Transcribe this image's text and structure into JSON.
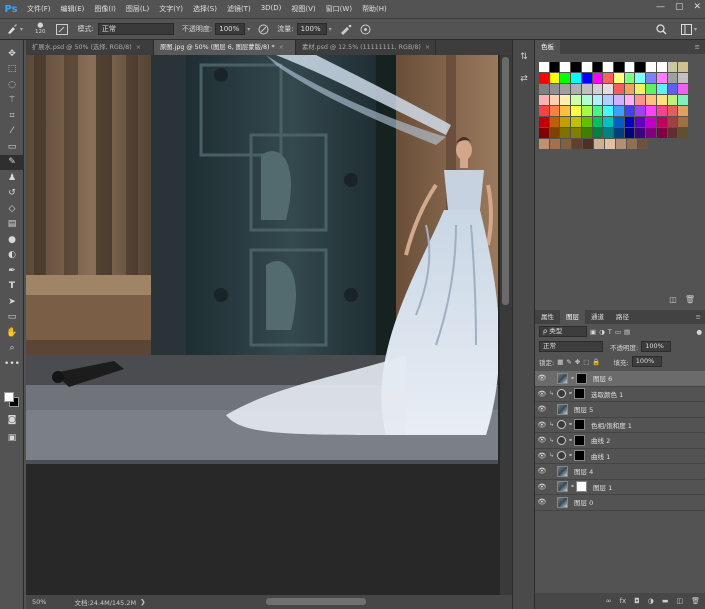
{
  "app": {
    "logo": "Ps",
    "menu": [
      "文件(F)",
      "编辑(E)",
      "图像(I)",
      "图层(L)",
      "文字(Y)",
      "选择(S)",
      "滤镜(T)",
      "3D(D)",
      "视图(V)",
      "窗口(W)",
      "帮助(H)"
    ],
    "window_controls": [
      "—",
      "▢",
      "✕"
    ]
  },
  "options": {
    "brush_size": "120",
    "mode_label": "模式:",
    "mode_value": "正常",
    "opacity_label": "不透明度:",
    "opacity_value": "100%",
    "flow_label": "流量:",
    "flow_value": "100%"
  },
  "tabs": [
    {
      "label": "扩展水.psd @ 50% (选择, RGB/8)",
      "close": "×"
    },
    {
      "label": "原图.jpg @ 50% (图层 6, 图层蒙版/8) *",
      "close": "×",
      "active": true
    },
    {
      "label": "素材.psd @ 12.5% (11111111, RGB/8)",
      "close": "×"
    }
  ],
  "status": {
    "zoom": "50%",
    "doc": "文档:24.4M/145.2M"
  },
  "swatches_panel": {
    "title": "色板",
    "menu": "≡",
    "colors": [
      [
        "#ffffff",
        "#000000",
        "#ffffff",
        "#000000",
        "#ffffff",
        "#000000",
        "#ffffff",
        "#000000",
        "#ffffff",
        "#000000",
        "#ffffff",
        "#ffffff",
        "#c8c8a0",
        "#d0c090"
      ],
      [
        "#ff0000",
        "#ffff00",
        "#00ff00",
        "#00ffff",
        "#0000ff",
        "#ff00ff",
        "#ff6060",
        "#ffff80",
        "#80ff80",
        "#80ffff",
        "#8080ff",
        "#ff80ff",
        "#a0a0a0",
        "#c0c0c0"
      ],
      [
        "#808080",
        "#909090",
        "#a0a0a0",
        "#b0b0b0",
        "#c0c0c0",
        "#d0d0d0",
        "#e0e0e0",
        "#f06060",
        "#f0a060",
        "#f0f060",
        "#60f060",
        "#60f0f0",
        "#6060f0",
        "#f060f0"
      ],
      [
        "#ffb0b0",
        "#ffd0b0",
        "#fff0b0",
        "#d0ffb0",
        "#b0ffd0",
        "#b0f0ff",
        "#b0d0ff",
        "#d0b0ff",
        "#ffb0f0",
        "#ff9090",
        "#ffc080",
        "#ffe080",
        "#c0f080",
        "#80f0c0"
      ],
      [
        "#ff4040",
        "#ff8040",
        "#ffc040",
        "#ffff40",
        "#a0ff40",
        "#40ff80",
        "#40ffff",
        "#40a0ff",
        "#4040ff",
        "#a040ff",
        "#ff40ff",
        "#ff4090",
        "#e06060",
        "#e0a060"
      ],
      [
        "#c00000",
        "#c06000",
        "#c0a000",
        "#c0c000",
        "#60c000",
        "#00c060",
        "#00c0c0",
        "#0060c0",
        "#0000c0",
        "#6000c0",
        "#c000c0",
        "#c00060",
        "#a04040",
        "#a07040"
      ],
      [
        "#800000",
        "#804000",
        "#807000",
        "#808000",
        "#408000",
        "#008040",
        "#008080",
        "#004080",
        "#000080",
        "#400080",
        "#800080",
        "#800040",
        "#603030",
        "#605030"
      ],
      [
        "#c09070",
        "#a07050",
        "#806040",
        "#604030",
        "#503020",
        "#d0b090",
        "#e0c0a0",
        "#b09070",
        "#907050",
        "#705040"
      ]
    ]
  },
  "layers_panel": {
    "tabs": [
      "属性",
      "图层",
      "通道",
      "路径"
    ],
    "active_tab": "图层",
    "menu": "≡",
    "filter": "ρ 类型",
    "blend_mode": "正常",
    "opacity_label": "不透明度:",
    "opacity_value": "100%",
    "lock_label": "锁定:",
    "fill_label": "填充:",
    "fill_value": "100%",
    "layers": [
      {
        "name": "图层 6",
        "type": "photo",
        "mask": "black",
        "selected": true,
        "clipped": false
      },
      {
        "name": "选取颜色 1",
        "type": "adj",
        "mask": "black",
        "selected": false,
        "clipped": true
      },
      {
        "name": "图层 5",
        "type": "photo",
        "mask": "",
        "selected": false,
        "clipped": false
      },
      {
        "name": "色相/饱和度 1",
        "type": "adj",
        "mask": "black",
        "selected": false,
        "clipped": true
      },
      {
        "name": "曲线 2",
        "type": "adj",
        "mask": "black",
        "selected": false,
        "clipped": true
      },
      {
        "name": "曲线 1",
        "type": "adj",
        "mask": "black",
        "selected": false,
        "clipped": true
      },
      {
        "name": "图层 4",
        "type": "photo",
        "mask": "",
        "selected": false,
        "clipped": false
      },
      {
        "name": "图层 1",
        "type": "photo",
        "mask": "white",
        "selected": false,
        "clipped": false
      },
      {
        "name": "图层 0",
        "type": "photo",
        "mask": "",
        "selected": false,
        "clipped": false
      }
    ],
    "footer_icons": [
      "link-icon",
      "fx-icon",
      "mask-icon",
      "adjustment-icon",
      "folder-icon",
      "new-layer-icon",
      "trash-icon"
    ]
  }
}
